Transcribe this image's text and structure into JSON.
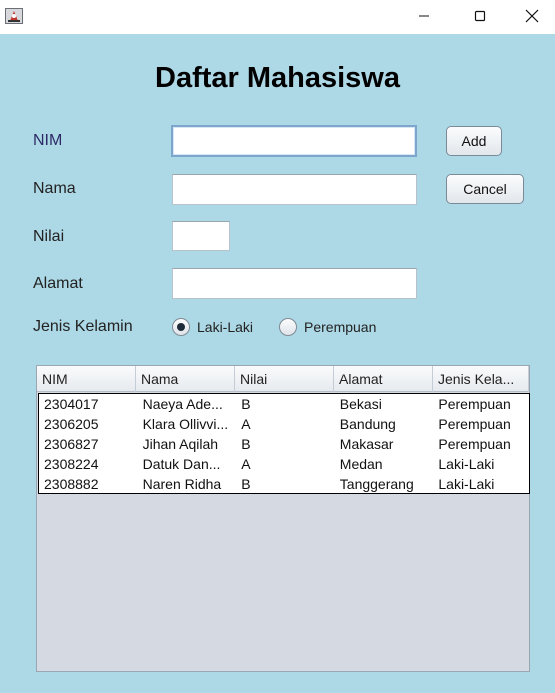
{
  "window": {
    "minimize_glyph": "—",
    "maximize_glyph": "☐",
    "close_glyph": "✕"
  },
  "form": {
    "title": "Daftar Mahasiswa",
    "nim_label": "NIM",
    "nama_label": "Nama",
    "nilai_label": "Nilai",
    "alamat_label": "Alamat",
    "jenis_kelamin_label": "Jenis Kelamin",
    "nim_value": "",
    "nama_value": "",
    "nilai_value": "",
    "alamat_value": "",
    "add_label": "Add",
    "cancel_label": "Cancel",
    "gender_options": [
      {
        "label": "Laki-Laki",
        "selected": true
      },
      {
        "label": "Perempuan",
        "selected": false
      }
    ]
  },
  "table": {
    "headers": [
      "NIM",
      "Nama",
      "Nilai",
      "Alamat",
      "Jenis Kela..."
    ],
    "rows": [
      [
        "2304017",
        "Naeya Ade...",
        "B",
        "Bekasi",
        "Perempuan"
      ],
      [
        "2306205",
        "Klara Ollivvi...",
        "A",
        "Bandung",
        "Perempuan"
      ],
      [
        "2306827",
        "Jihan Aqilah",
        "B",
        "Makasar",
        "Perempuan"
      ],
      [
        "2308224",
        "Datuk Dan...",
        "A",
        "Medan",
        "Laki-Laki"
      ],
      [
        "2308882",
        "Naren Ridha",
        "B",
        "Tanggerang",
        "Laki-Laki"
      ]
    ]
  },
  "colors": {
    "background": "#add8e6",
    "table_empty_area": "#d5d9e1"
  }
}
